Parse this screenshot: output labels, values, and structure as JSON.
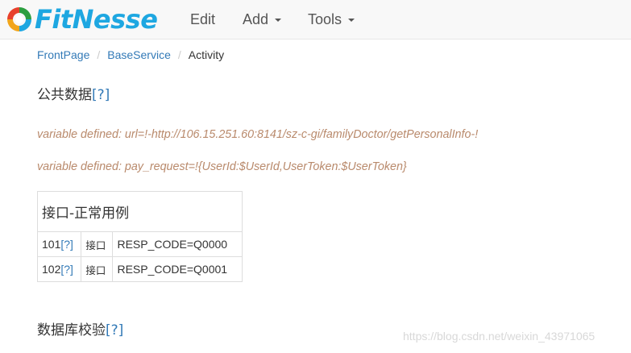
{
  "navbar": {
    "brand": "FitNesse",
    "menu": [
      {
        "label": "Edit"
      },
      {
        "label": "Add"
      },
      {
        "label": "Tools"
      }
    ]
  },
  "breadcrumb": {
    "items": [
      {
        "label": "FrontPage"
      },
      {
        "label": "BaseService"
      }
    ],
    "current": "Activity"
  },
  "sections": {
    "common_data": {
      "title": "公共数据",
      "help": "[?]"
    },
    "db_check": {
      "title": "数据库校验",
      "help": "[?]"
    }
  },
  "variables": [
    "variable defined: url=!-http://106.15.251.60:8141/sz-c-gi/familyDoctor/getPersonalInfo-!",
    "variable defined: pay_request=!{UserId:$UserId,UserToken:$UserToken}"
  ],
  "table": {
    "header": "接口-正常用例",
    "rows": [
      {
        "id": "101",
        "help": "[?]",
        "type": "接口",
        "value": "RESP_CODE=Q0000"
      },
      {
        "id": "102",
        "help": "[?]",
        "type": "接口",
        "value": "RESP_CODE=Q0001"
      }
    ]
  },
  "watermark": "https://blog.csdn.net/weixin_43971065",
  "colors": {
    "brand": "#1ea7e1",
    "link": "#337ab7",
    "variable_text": "#b98a6c",
    "navbar_bg": "#f8f8f8"
  }
}
